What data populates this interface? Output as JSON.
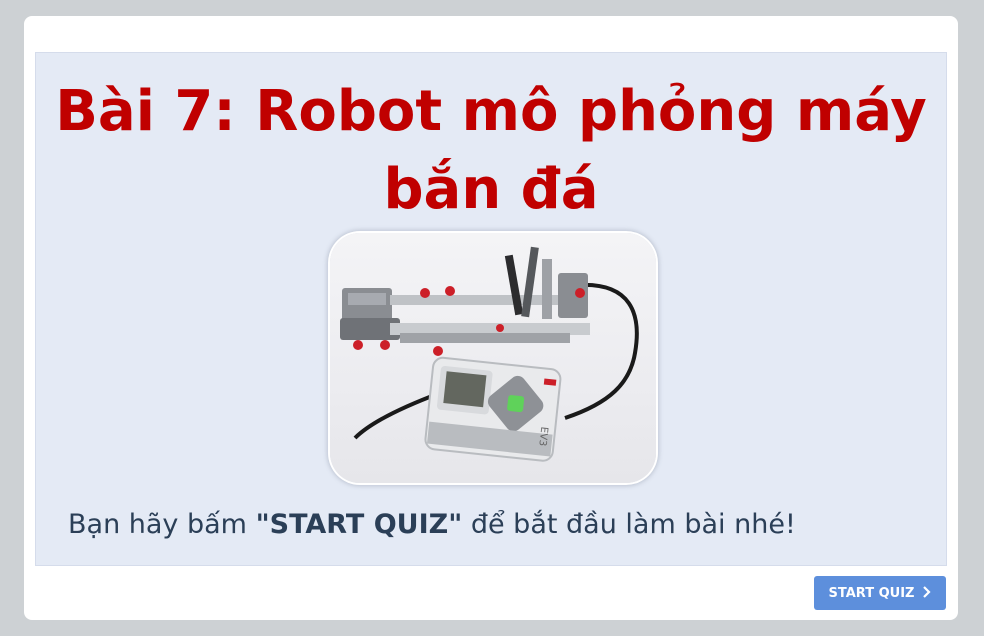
{
  "slide": {
    "title": "Bài 7: Robot mô phỏng máy bắn đá",
    "image_alt": "",
    "instruction_prefix": "Bạn hãy bấm ",
    "instruction_emphasis": "\"START QUIZ\"",
    "instruction_suffix": " để bắt đầu làm bài nhé!",
    "robot_brick_label": "EV3"
  },
  "footer": {
    "start_button_label": "START QUIZ",
    "start_button_icon": "chevron-right-icon"
  },
  "colors": {
    "title": "#c00000",
    "slide_background": "#e4eaf5",
    "button_background": "#5d8fdc",
    "page_background": "#cdd1d4"
  }
}
